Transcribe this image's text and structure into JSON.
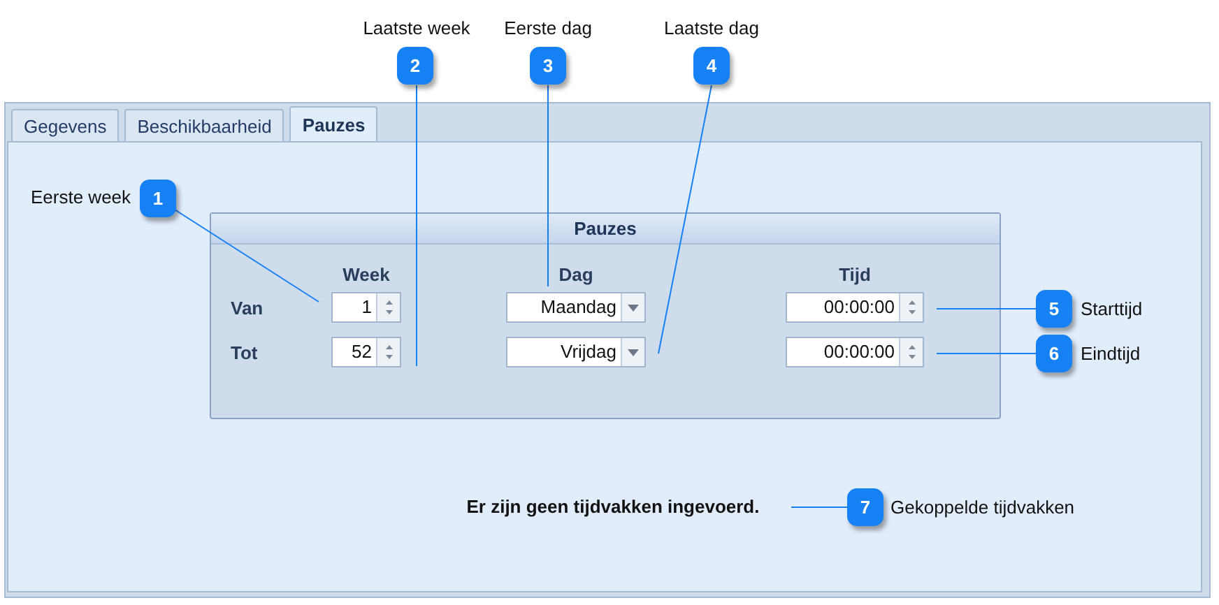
{
  "tabs": [
    {
      "label": "Gegevens",
      "selected": false
    },
    {
      "label": "Beschikbaarheid",
      "selected": false
    },
    {
      "label": "Pauzes",
      "selected": true
    }
  ],
  "group": {
    "title": "Pauzes",
    "columns": [
      "Week",
      "Dag",
      "Tijd"
    ],
    "rows": [
      {
        "label": "Van",
        "week": "1",
        "day": "Maandag",
        "time": "00:00:00"
      },
      {
        "label": "Tot",
        "week": "52",
        "day": "Vrijdag",
        "time": "00:00:00"
      }
    ]
  },
  "message": "Er zijn geen tijdvakken ingevoerd.",
  "callouts": [
    {
      "number": "1",
      "label": "Eerste week"
    },
    {
      "number": "2",
      "label": "Laatste week"
    },
    {
      "number": "3",
      "label": "Eerste dag"
    },
    {
      "number": "4",
      "label": "Laatste dag"
    },
    {
      "number": "5",
      "label": "Starttijd"
    },
    {
      "number": "6",
      "label": "Eindtijd"
    },
    {
      "number": "7",
      "label": "Gekoppelde tijdvakken"
    }
  ]
}
